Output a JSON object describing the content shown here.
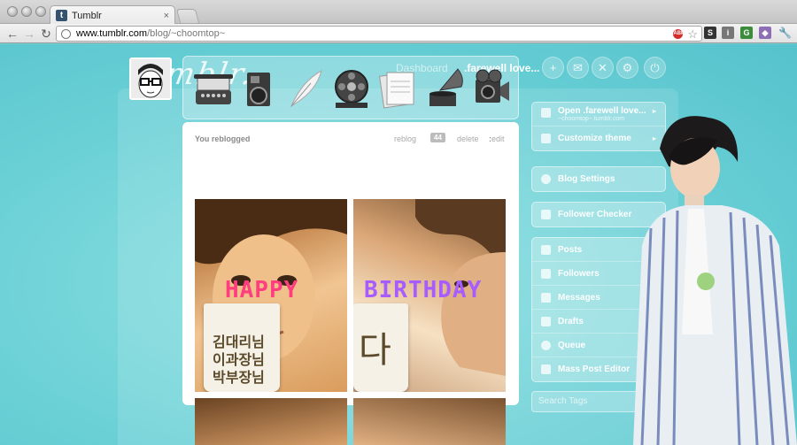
{
  "browser": {
    "tab_title": "Tumblr",
    "tab_favicon": "t",
    "tab_close": "×",
    "url_host": "www.tumblr.com",
    "url_path": "/blog/~choomtop~",
    "abp_label": "ABP",
    "star_icon": "☆"
  },
  "nav": {
    "logo": "tumblr.",
    "dashboard": "Dashboard",
    "blog": ".farewell love...",
    "icons": [
      "plus-icon",
      "mail-icon",
      "x-icon",
      "gear-icon",
      "power-icon"
    ]
  },
  "post_types": [
    "typewriter-icon",
    "camera-icon",
    "quill-icon",
    "film-reel-icon",
    "papers-icon",
    "gramophone-icon",
    "video-camera-icon"
  ],
  "post": {
    "header": "You reblogged",
    "colon": ":",
    "reblog": "reblog",
    "notes": "44",
    "delete": "delete",
    "edit": "edit",
    "word_left": "HAPPY",
    "word_right": "BIRTHDAY",
    "mug_lines": [
      "김대리님",
      "이과장님",
      "박부장님"
    ],
    "mug_right": "다"
  },
  "sidebar": {
    "blog_title": "Open .farewell love...",
    "blog_url": "~choomtop~.tumblr.com",
    "customize": "Customize theme",
    "blog_settings": "Blog Settings",
    "follower_checker": "Follower Checker",
    "stats": [
      {
        "label": "Posts",
        "icon": "posts-icon"
      },
      {
        "label": "Followers",
        "icon": "followers-icon"
      },
      {
        "label": "Messages",
        "icon": "messages-icon"
      },
      {
        "label": "Drafts",
        "icon": "drafts-icon"
      },
      {
        "label": "Queue",
        "icon": "queue-icon"
      },
      {
        "label": "Mass Post Editor",
        "icon": "editor-icon"
      }
    ],
    "search_placeholder": "Search Tags"
  },
  "colors": {
    "page_bg": "#6fd0d4",
    "word_left": "#ff3d7f",
    "word_right": "#a65cff"
  }
}
